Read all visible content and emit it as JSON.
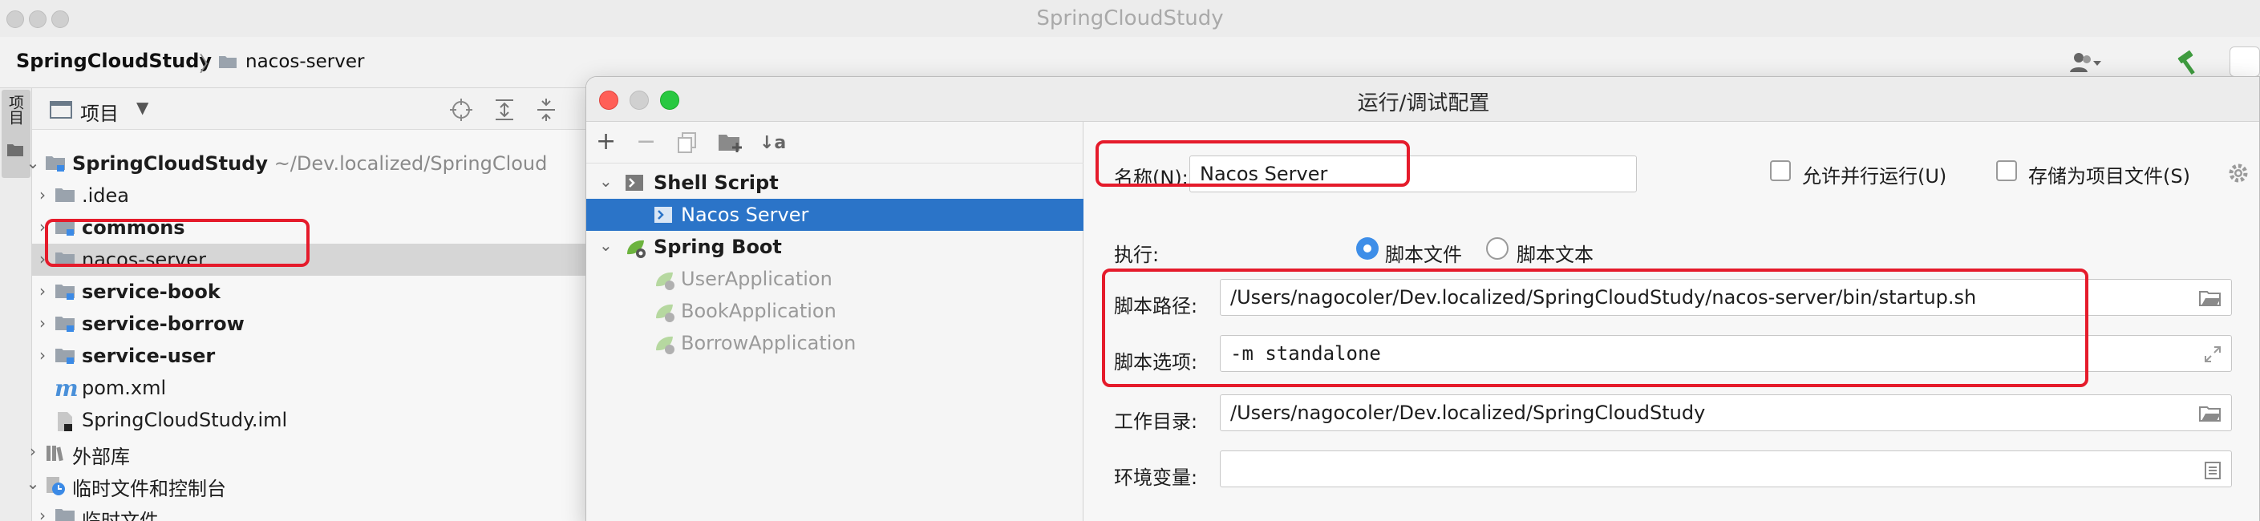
{
  "window": {
    "title": "SpringCloudStudy"
  },
  "navbar": {
    "breadcrumb_project": "SpringCloudStudy",
    "breadcrumb_separator": "〉",
    "breadcrumb_module": "nacos-server"
  },
  "tool_strip": {
    "project_tab": "项目"
  },
  "project_panel": {
    "title": "项目",
    "tree": [
      {
        "label": "SpringCloudStudy",
        "sub": " ~/Dev.localized/SpringCloud",
        "bold": true,
        "icon": "folder-module-icon"
      },
      {
        "label": ".idea",
        "icon": "folder-icon"
      },
      {
        "label": "commons",
        "bold": true,
        "icon": "folder-module-icon"
      },
      {
        "label": "nacos-server",
        "icon": "folder-icon"
      },
      {
        "label": "service-book",
        "bold": true,
        "icon": "folder-module-icon"
      },
      {
        "label": "service-borrow",
        "bold": true,
        "icon": "folder-module-icon"
      },
      {
        "label": "service-user",
        "bold": true,
        "icon": "folder-module-icon"
      },
      {
        "label": "pom.xml",
        "icon": "maven-icon"
      },
      {
        "label": "SpringCloudStudy.iml",
        "icon": "iml-file-icon"
      },
      {
        "label": "外部库",
        "icon": "library-icon"
      },
      {
        "label": "临时文件和控制台",
        "icon": "scratch-icon"
      },
      {
        "label": "临时文件",
        "icon": "folder-icon"
      }
    ]
  },
  "dialog": {
    "title": "运行/调试配置",
    "toolbar": {
      "add": "+",
      "remove": "−",
      "sort": "↓a"
    },
    "config_tree": [
      {
        "label": "Shell Script",
        "bold": true,
        "type": "group"
      },
      {
        "label": "Nacos Server",
        "type": "item"
      },
      {
        "label": "Spring Boot",
        "bold": true,
        "type": "group"
      },
      {
        "label": "UserApplication",
        "type": "item"
      },
      {
        "label": "BookApplication",
        "type": "item"
      },
      {
        "label": "BorrowApplication",
        "type": "item"
      }
    ],
    "form": {
      "name_label": "名称(N):",
      "name_value": "Nacos Server",
      "allow_parallel_label": "允许并行运行(U)",
      "store_as_file_label": "存储为项目文件(S)",
      "execute_label": "执行:",
      "radio_script_file": "脚本文件",
      "radio_script_text": "脚本文本",
      "script_path_label": "脚本路径:",
      "script_path_value": "/Users/nagocoler/Dev.localized/SpringCloudStudy/nacos-server/bin/startup.sh",
      "script_options_label": "脚本选项:",
      "script_options_value": "-m standalone",
      "work_dir_label": "工作目录:",
      "work_dir_value": "/Users/nagocoler/Dev.localized/SpringCloudStudy",
      "env_label": "环境变量:",
      "env_value": ""
    }
  },
  "colors": {
    "highlight": "#e51b2b",
    "selection": "#2b74c8",
    "radio_on": "#3e8ee8"
  }
}
